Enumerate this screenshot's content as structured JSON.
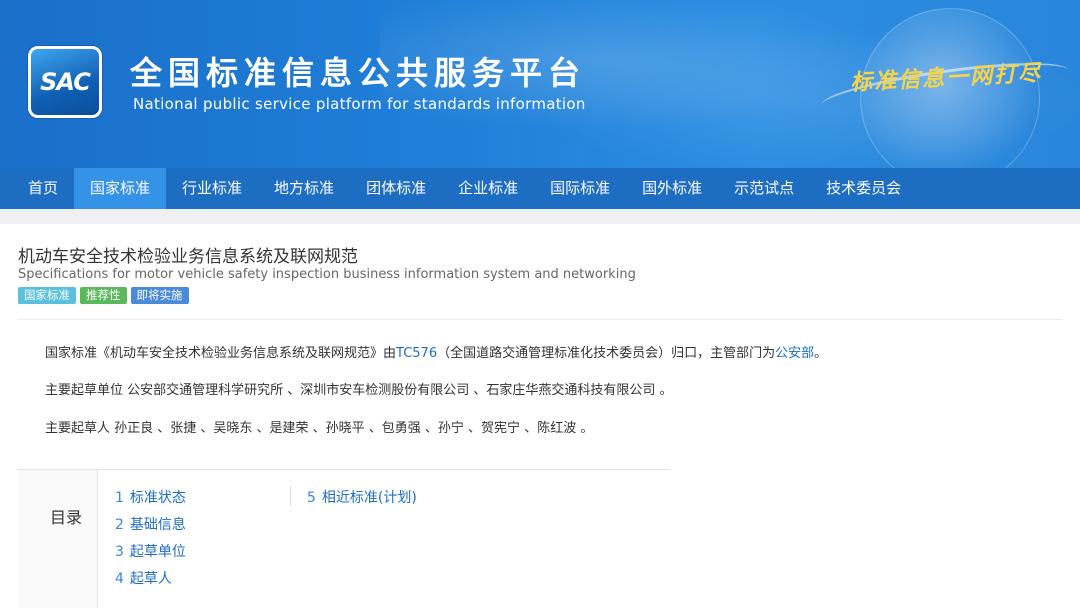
{
  "header": {
    "logo_text": "SAC",
    "title_cn": "全国标准信息公共服务平台",
    "title_en": "National public service platform  for standards information",
    "slogan": "标准信息一网打尽"
  },
  "nav": {
    "items": [
      {
        "label": "首页",
        "active": false
      },
      {
        "label": "国家标准",
        "active": true
      },
      {
        "label": "行业标准",
        "active": false
      },
      {
        "label": "地方标准",
        "active": false
      },
      {
        "label": "团体标准",
        "active": false
      },
      {
        "label": "企业标准",
        "active": false
      },
      {
        "label": "国际标准",
        "active": false
      },
      {
        "label": "国外标准",
        "active": false
      },
      {
        "label": "示范试点",
        "active": false
      },
      {
        "label": "技术委员会",
        "active": false
      }
    ]
  },
  "standard": {
    "title_cn": "机动车安全技术检验业务信息系统及联网规范",
    "title_en": "Specifications for motor vehicle safety inspection business information system and networking",
    "tags": [
      {
        "label": "国家标准",
        "color": "#5bc0de"
      },
      {
        "label": "推荐性",
        "color": "#5cb85c"
      },
      {
        "label": "即将实施",
        "color": "#4a8ad8"
      }
    ],
    "desc": {
      "prefix": "国家标准《机动车安全技术检验业务信息系统及联网规范》由",
      "tc_link": "TC576",
      "mid": "（全国道路交通管理标准化技术委员会）归口，主管部门为",
      "dept_link": "公安部",
      "suffix": "。"
    },
    "drafting_units": "主要起草单位 公安部交通管理科学研究所 、深圳市安车检测股份有限公司 、石家庄华燕交通科技有限公司 。",
    "drafters": "主要起草人 孙正良 、张捷 、吴晓东 、是建荣 、孙晓平 、包勇强 、孙宁 、贺宪宁 、陈红波 。"
  },
  "toc": {
    "label": "目录",
    "items": [
      {
        "num": "1",
        "label": "标准状态"
      },
      {
        "num": "2",
        "label": "基础信息"
      },
      {
        "num": "3",
        "label": "起草单位"
      },
      {
        "num": "4",
        "label": "起草人"
      },
      {
        "num": "5",
        "label": "相近标准(计划)"
      }
    ]
  }
}
